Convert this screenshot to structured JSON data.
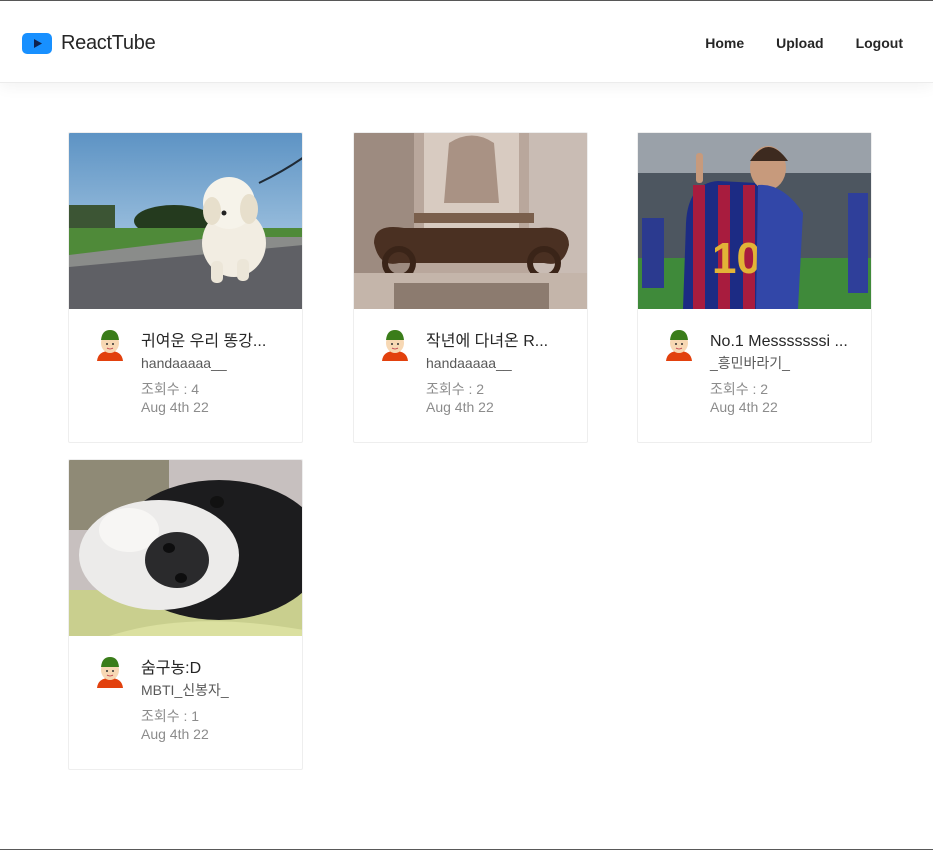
{
  "header": {
    "logo_text": "ReactTube",
    "brand_color": "#1890ff",
    "nav": {
      "home": "Home",
      "upload": "Upload",
      "logout": "Logout"
    }
  },
  "videos": [
    {
      "title": "귀여운 우리 똥강...",
      "uploader": "handaaaaa__",
      "views": "조회수 : 4",
      "date": "Aug 4th 22",
      "thumbnail": "white-puppy-walking"
    },
    {
      "title": "작년에 다녀온 R...",
      "uploader": "handaaaaa__",
      "views": "조회수 : 2",
      "date": "Aug 4th 22",
      "thumbnail": "ornate-stone-monument"
    },
    {
      "title": "No.1 Messsssssi ...",
      "uploader": "_흥민바라기_",
      "views": "조회수 : 2",
      "date": "Aug 4th 22",
      "thumbnail": "football-player-celebrating"
    },
    {
      "title": "숨구농:D",
      "uploader": "MBTI_신봉자_",
      "views": "조회수 : 1",
      "date": "Aug 4th 22",
      "thumbnail": "dog-nose-closeup"
    }
  ]
}
